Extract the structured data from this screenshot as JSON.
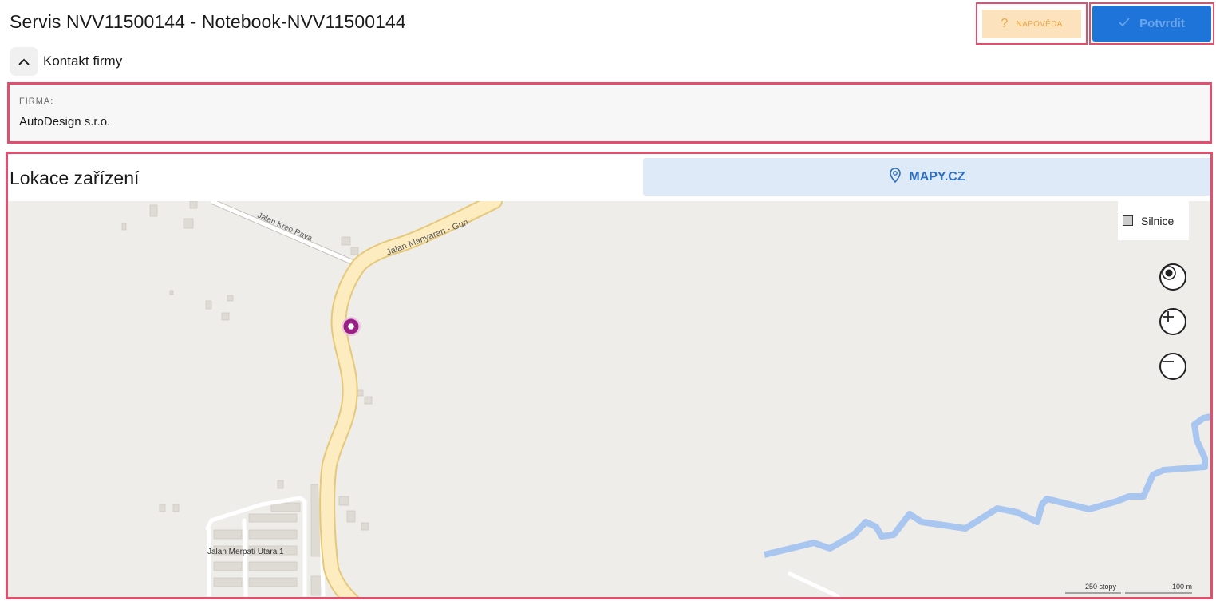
{
  "header": {
    "title": "Servis NVV11500144 - Notebook-NVV11500144",
    "help_label": "NÁPOVĚDA",
    "confirm_label": "Potvrdit"
  },
  "contact": {
    "toggle_label": "Kontakt firmy",
    "firm_key": "FIRMA:",
    "firm_value": "AutoDesign s.r.o."
  },
  "location": {
    "title": "Lokace zařízení",
    "map_button_label": "MAPY.CZ",
    "layer_label": "Silnice",
    "streets": [
      "Jalan Kreo Raya",
      "Jalan Manyaran - Gun",
      "Jalan Merpati Utara 1"
    ],
    "scale_imperial": "250 stopy",
    "scale_metric": "100 m"
  },
  "colors": {
    "accent": "#1e74d8",
    "help_bg": "#fde3bd",
    "highlight_border": "#e0506e",
    "road_fill": "#fcecc0",
    "river": "#a9c6f0",
    "marker": "#9a1f86"
  },
  "icons": {
    "help": "question-mark-icon",
    "confirm": "checkmark-icon",
    "toggle": "chevron-up-icon",
    "map_button": "location-pin-icon",
    "locate": "locate-icon",
    "zoom_in": "zoom-in-icon",
    "zoom_out": "zoom-out-icon"
  }
}
